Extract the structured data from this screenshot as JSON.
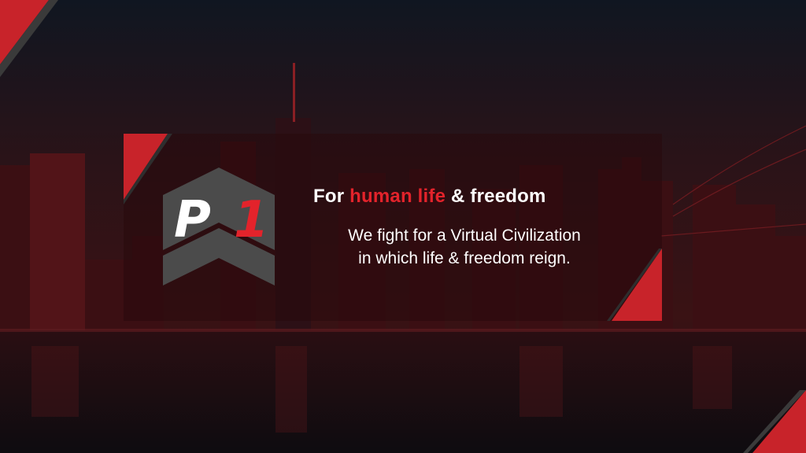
{
  "banner": {
    "headline": {
      "part1": "For ",
      "accent": "human life",
      "part2": " & freedom"
    },
    "subtext_line1": "We fight for a Virtual Civilization",
    "subtext_line2": "in which life & freedom reign.",
    "logo": {
      "letter": "P",
      "digit": "1",
      "icon": "p1-logo-icon"
    }
  },
  "colors": {
    "accent": "#e3232b",
    "background": "#0d1118",
    "logo_gray": "#4b4b4b"
  }
}
